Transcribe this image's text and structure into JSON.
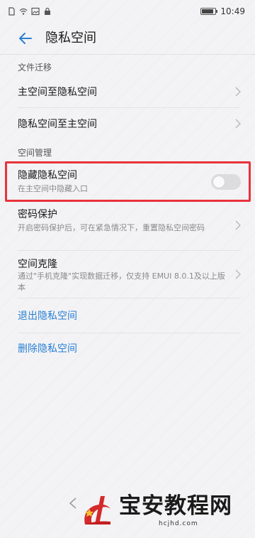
{
  "statusbar": {
    "time": "10:49",
    "left_icons": [
      "sim-icon",
      "wifi-icon",
      "image-icon",
      "lock-icon"
    ],
    "battery_level": 0.9
  },
  "titlebar": {
    "title": "隐私空间",
    "back_icon": "arrow-left-icon"
  },
  "sections": {
    "file_migration": {
      "header": "文件迁移",
      "items": [
        {
          "label": "主空间至隐私空间"
        },
        {
          "label": "隐私空间至主空间"
        }
      ]
    },
    "space_management": {
      "header": "空间管理",
      "hide": {
        "label": "隐藏隐私空间",
        "sub": "在主空间中隐藏入口",
        "enabled": false
      },
      "password": {
        "label": "密码保护",
        "sub": "开启密码保护后，可在紧急情况下，重置隐私空间密码"
      },
      "clone": {
        "label": "空间克隆",
        "sub": "通过\"手机克隆\"实现数据迁移，仅支持 EMUI 8.0.1及以上版本"
      }
    }
  },
  "links": {
    "exit": "退出隐私空间",
    "delete": "删除隐私空间"
  },
  "watermark": {
    "text": "宝安教程网",
    "url": "hcjhd.com"
  },
  "colors": {
    "accent": "#2a7fd4",
    "highlight": "#e9323a",
    "background": "#f3f3f5"
  }
}
